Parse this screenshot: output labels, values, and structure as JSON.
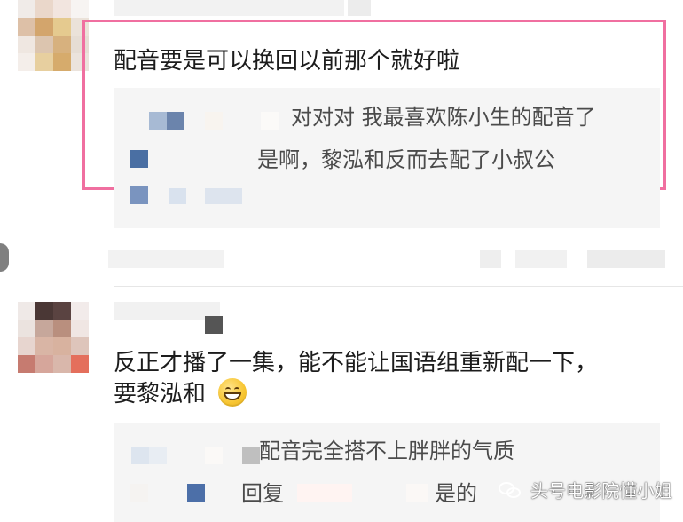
{
  "comments": {
    "first": {
      "text": "配音要是可以换回以前那个就好啦",
      "replies": [
        "对对对 我最喜欢陈小生的配音了",
        "是啊，黎泓和反而去配了小叔公"
      ]
    },
    "second": {
      "line1": "反正才播了一集，能不能让国语组重新配一下，",
      "line2": "要黎泓和",
      "emoji": "grin-emoji",
      "replies": {
        "first": "配音完全搭不上胖胖的气质",
        "reply_prefix": "回复",
        "reply_suffix": "是的"
      }
    }
  },
  "watermark": {
    "text": "头号电影院懂小姐",
    "icon": "wechat-bubble-icon"
  },
  "colors": {
    "highlight": "#f06fa0",
    "reply_bg": "#f5f5f5",
    "text": "#1c1c1c"
  }
}
